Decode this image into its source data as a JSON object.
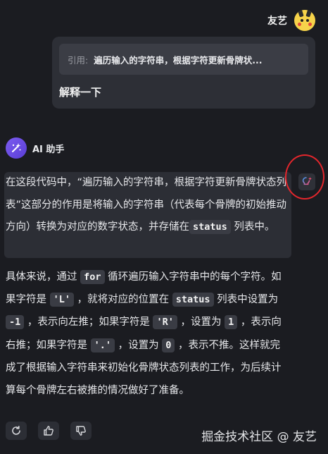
{
  "user": {
    "name": "友艺"
  },
  "quote": {
    "label": "引用:",
    "text": "遍历输入的字符串，根据字符更新骨牌状..."
  },
  "user_message": "解释一下",
  "assistant": {
    "name": "AI 助手",
    "paragraph1": {
      "t1": "在这段代码中，“遍历输入的字符串，根据字符更新骨牌状态列表”这部分的作用是将输入的字符串（代表每个骨牌的初始推动方向）转换为对应的数字状态，并存储在",
      "code1": "status",
      "t2": " 列表中。"
    },
    "paragraph2": {
      "t1": "具体来说，通过 ",
      "c1": "for",
      "t2": " 循环遍历输入字符串中的每个字符。如果字符是 ",
      "c2": "'L'",
      "t3": " ，就将对应的位置在 ",
      "c3": "status",
      "t4": " 列表中设置为 ",
      "c4": "-1",
      "t5": " ，表示向左推；如果字符是 ",
      "c5": "'R'",
      "t6": " ，设置为 ",
      "c6": "1",
      "t7": " ，表示向右推；如果字符是 ",
      "c7": "'.'",
      "t8": " ，设置为 ",
      "c8": "0",
      "t9": " ，表示不推。这样就完成了根据输入字符串来初始化骨牌状态列表的工作，为后续计算每个骨牌左右被推的情况做好了准备。"
    }
  },
  "icons": {
    "user_avatar": "pikachu-avatar",
    "assistant_avatar": "sparkle-icon",
    "explain": "lightbulb-sparkle-icon",
    "regenerate": "refresh-icon",
    "like": "thumbs-up-icon",
    "dislike": "thumbs-down-icon"
  },
  "colors": {
    "background": "#1b1c21",
    "bubble": "#2d2f36",
    "accent": "#7c5cf0",
    "annotation": "#e3262c"
  },
  "watermark": "掘金技术社区 @ 友艺"
}
